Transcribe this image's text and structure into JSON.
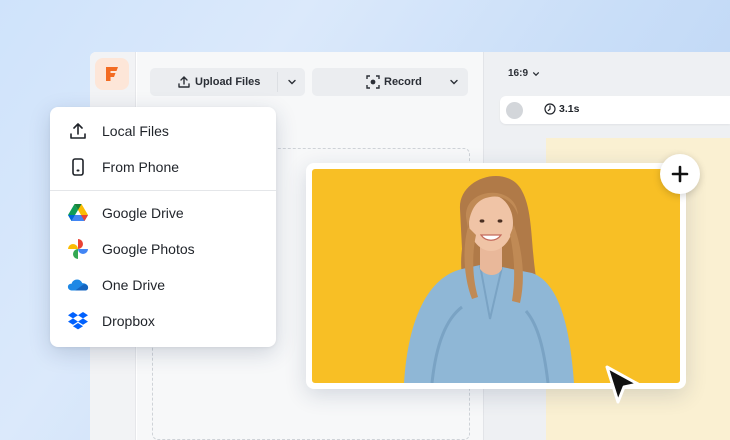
{
  "toolbar": {
    "upload_label": "Upload Files",
    "record_label": "Record"
  },
  "stage": {
    "aspect_ratio": "16:9",
    "clip_duration": "3.1s"
  },
  "upload_menu": {
    "items": [
      {
        "label": "Local Files",
        "icon": "upload-icon"
      },
      {
        "label": "From Phone",
        "icon": "phone-icon"
      },
      {
        "label": "Google Drive",
        "icon": "google-drive-icon"
      },
      {
        "label": "Google Photos",
        "icon": "google-photos-icon"
      },
      {
        "label": "One Drive",
        "icon": "onedrive-icon"
      },
      {
        "label": "Dropbox",
        "icon": "dropbox-icon"
      }
    ]
  },
  "colors": {
    "brand": "#f36b21",
    "photo_background": "#f8bf25",
    "canvas_background": "#faf0d2"
  }
}
